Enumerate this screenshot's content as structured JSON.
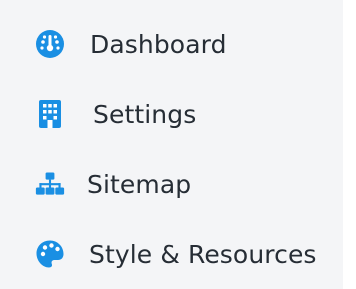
{
  "nav": {
    "accent_color": "#1a8fe3",
    "items": [
      {
        "label": "Dashboard",
        "icon": "dashboard-gauge-icon"
      },
      {
        "label": "Settings",
        "icon": "building-icon"
      },
      {
        "label": "Sitemap",
        "icon": "sitemap-icon"
      },
      {
        "label": "Style & Resources",
        "icon": "palette-icon"
      }
    ]
  }
}
